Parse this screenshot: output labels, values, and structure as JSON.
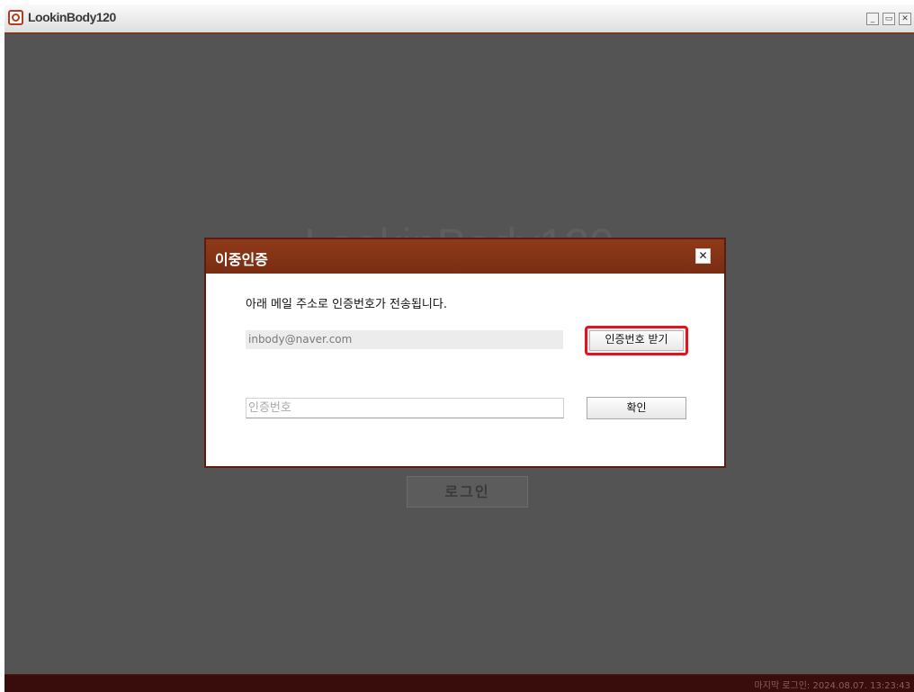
{
  "window": {
    "app_title": "LookinBody120",
    "logo_icon": "inbody-logo-icon",
    "controls": {
      "minimize_icon": "minimize-icon",
      "maximize_icon": "maximize-icon",
      "close_icon": "close-icon"
    }
  },
  "background": {
    "app_heading": "LookinBody120",
    "login_button": "로그인"
  },
  "dialog": {
    "title": "이중인증",
    "close_icon": "close-icon",
    "description": "아래 메일 주소로 인증번호가 전송됩니다.",
    "email_value": "inbody@naver.com",
    "request_code_button": "인증번호 받기",
    "code_placeholder": "인증번호",
    "confirm_button": "확인"
  },
  "status": {
    "last_login": "마지막 로그인: 2024.08.07. 13:23:43"
  },
  "colors": {
    "accent": "#7a2d12",
    "highlight": "#e0141e",
    "background": "#545454"
  }
}
